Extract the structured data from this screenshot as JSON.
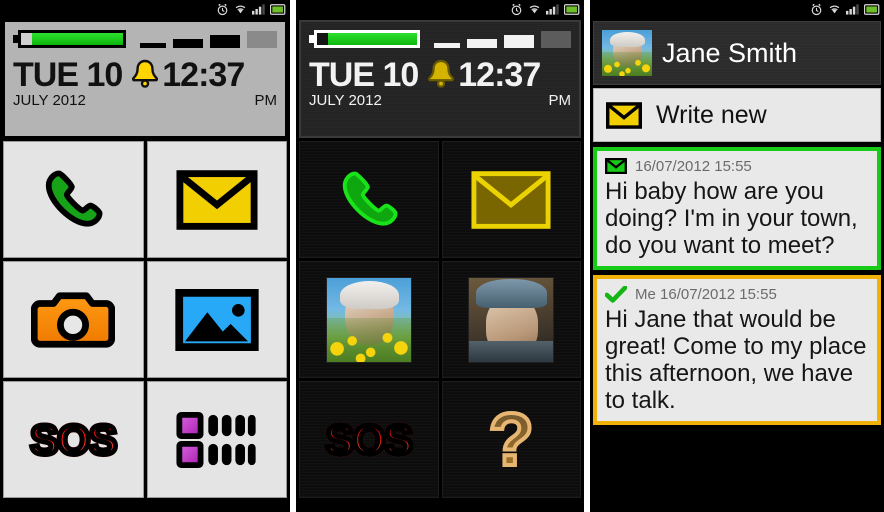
{
  "statusbar": {
    "icons": [
      "alarm-clock-icon",
      "wifi-icon",
      "signal-bars-icon",
      "battery-icon"
    ]
  },
  "clock": {
    "day": "TUE 10",
    "month_year": "JULY 2012",
    "time": "12:37",
    "ampm": "PM",
    "alarm_icon": "bell-icon",
    "battery_percent": 89,
    "signal_bars": 3
  },
  "panel1": {
    "theme": "light",
    "tiles": [
      {
        "name": "phone",
        "icon": "phone-handset-icon",
        "label": ""
      },
      {
        "name": "messages",
        "icon": "envelope-icon",
        "label": ""
      },
      {
        "name": "camera",
        "icon": "camera-icon",
        "label": ""
      },
      {
        "name": "gallery",
        "icon": "picture-icon",
        "label": ""
      },
      {
        "name": "sos",
        "icon": "sos-text-icon",
        "label": "SOS"
      },
      {
        "name": "apps",
        "icon": "apps-grid-icon",
        "label": ""
      }
    ]
  },
  "panel2": {
    "theme": "dark",
    "tiles": [
      {
        "name": "phone",
        "icon": "phone-handset-icon",
        "label": ""
      },
      {
        "name": "messages",
        "icon": "envelope-icon",
        "label": ""
      },
      {
        "name": "contact-grandmother",
        "icon": "contact-photo-grandmother",
        "label": ""
      },
      {
        "name": "contact-grandfather",
        "icon": "contact-photo-grandfather",
        "label": ""
      },
      {
        "name": "sos",
        "icon": "sos-text-icon",
        "label": "SOS"
      },
      {
        "name": "help",
        "icon": "question-mark-icon",
        "label": "?"
      }
    ]
  },
  "panel3": {
    "contact": {
      "name": "Jane Smith",
      "avatar": "contact-photo-grandmother"
    },
    "write_new": {
      "label": "Write new",
      "icon": "envelope-icon"
    },
    "messages": [
      {
        "direction": "inbound",
        "status_icon": "envelope-icon",
        "meta": "16/07/2012 15:55",
        "body": "Hi baby how are you doing? I'm in your town, do you want to meet?",
        "accent": "#17cc17"
      },
      {
        "direction": "outbound",
        "status_icon": "check-icon",
        "meta": "Me 16/07/2012 15:55",
        "body": "Hi Jane that would be great! Come to my place this afternoon, we have to talk.",
        "accent": "#f0b208"
      }
    ]
  },
  "colors": {
    "green": "#17cc17",
    "yellow": "#f0d000",
    "orange": "#f08000",
    "blue": "#2196f3",
    "red": "#ff1212",
    "purple": "#bf3fbf"
  }
}
